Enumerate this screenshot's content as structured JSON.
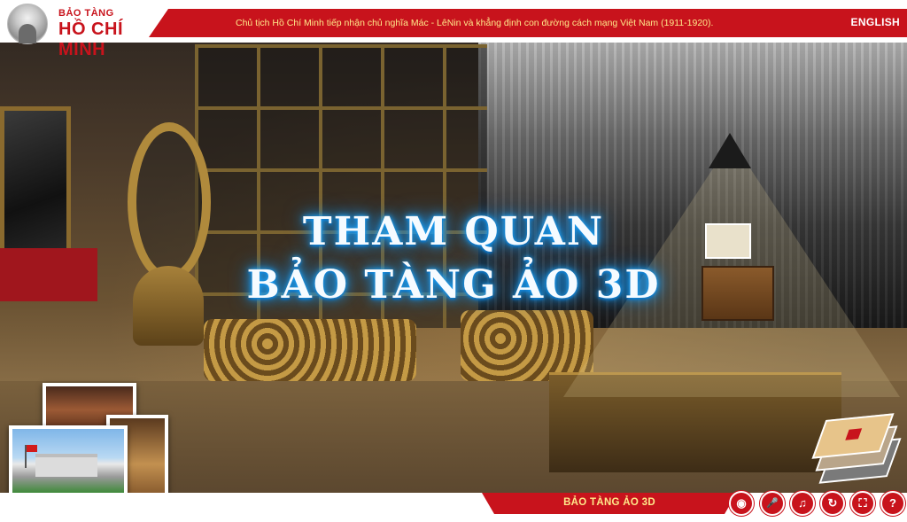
{
  "header": {
    "logo_small": "BẢO TÀNG",
    "logo_big": "HỒ CHÍ MINH",
    "tagline": "Chủ tịch Hồ Chí Minh tiếp nhận chủ nghĩa Mác - LêNin và khẳng định con đường cách mạng Việt Nam (1911-1920).",
    "language_link": "ENGLISH"
  },
  "hero": {
    "title_line1": "THAM QUAN",
    "title_line2": "BẢO TÀNG ẢO 3D"
  },
  "footer": {
    "tab_label": "BẢO TÀNG ẢO 3D",
    "controls": [
      {
        "icon": "compass-icon",
        "glyph": "◉"
      },
      {
        "icon": "microphone-icon",
        "glyph": "🎤"
      },
      {
        "icon": "music-icon",
        "glyph": "♫"
      },
      {
        "icon": "refresh-icon",
        "glyph": "↻"
      },
      {
        "icon": "fullscreen-icon",
        "glyph": "⛶"
      },
      {
        "icon": "help-icon",
        "glyph": "?"
      }
    ]
  },
  "colors": {
    "brand_red": "#c8131c",
    "tagline_yellow": "#ffe98a",
    "title_glow": "#1aa6ff"
  }
}
